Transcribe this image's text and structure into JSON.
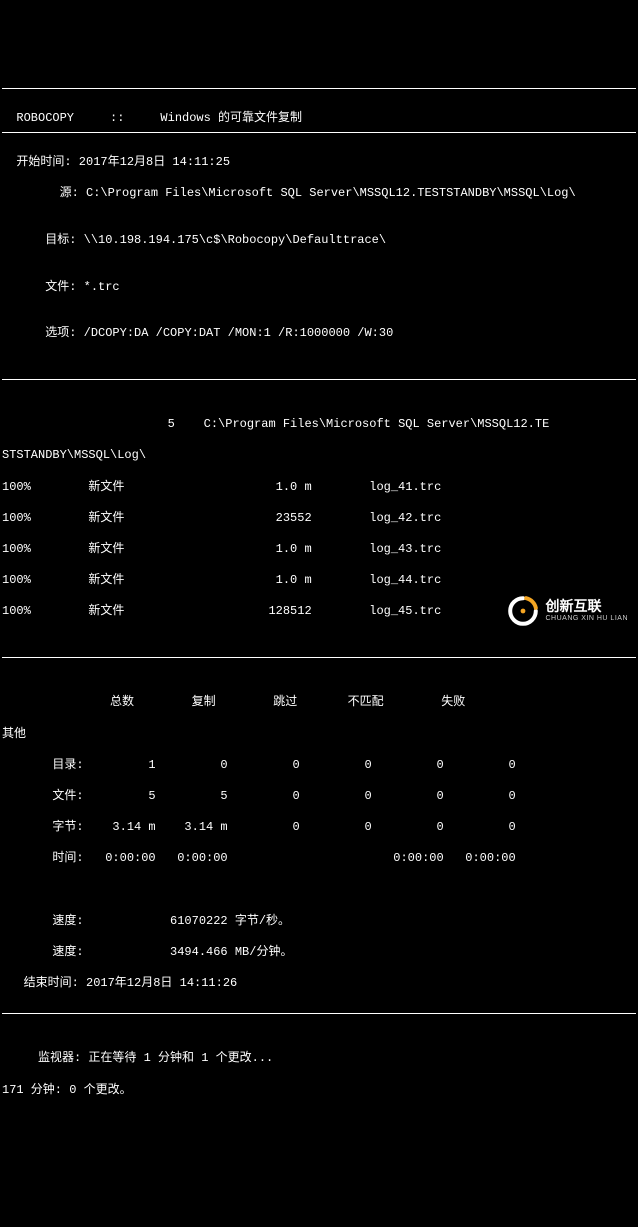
{
  "header": {
    "title": "  ROBOCOPY     ::     Windows 的可靠文件复制"
  },
  "info": {
    "start_label": "  开始时间:",
    "start_value": " 2017年12月8日 14:11:25",
    "source_label": "        源:",
    "source_value": " C:\\Program Files\\Microsoft SQL Server\\MSSQL12.TESTSTANDBY\\MSSQL\\Log\\",
    "target_label": "      目标:",
    "target_value": " \\\\10.198.194.175\\c$\\Robocopy\\Defaulttrace\\",
    "file_label": "      文件:",
    "file_value": " *.trc",
    "option_label": "      选项:",
    "option_value": " /DCOPY:DA /COPY:DAT /MON:1 /R:1000000 /W:30"
  },
  "path": {
    "count": "                       5",
    "value": "    C:\\Program Files\\Microsoft SQL Server\\MSSQL12.TE",
    "cont": "STSTANDBY\\MSSQL\\Log\\"
  },
  "rows": [
    "100%        新文件                     1.0 m        log_41.trc",
    "100%        新文件                     23552        log_42.trc",
    "100%        新文件                     1.0 m        log_43.trc",
    "100%        新文件                     1.0 m        log_44.trc",
    "100%        新文件                    128512        log_45.trc"
  ],
  "table": {
    "header": "               总数        复制        跳过       不匹配        失败",
    "other_label": "其他",
    "rows": [
      "       目录:         1         0         0         0         0         0",
      "       文件:         5         5         0         0         0         0",
      "       字节:    3.14 m    3.14 m         0         0         0         0",
      "       时间:   0:00:00   0:00:00                       0:00:00   0:00:00"
    ]
  },
  "footer": {
    "speed1": "       速度:            61070222 字节/秒。",
    "speed2": "       速度:            3494.466 MB/分钟。",
    "end": "   结束时间: 2017年12月8日 14:11:26",
    "monitor": "     监视器: 正在等待 1 分钟和 1 个更改...",
    "wait": "171 分钟: 0 个更改。"
  },
  "logo": {
    "cn": "创新互联",
    "en": "CHUANG XIN HU LIAN"
  }
}
